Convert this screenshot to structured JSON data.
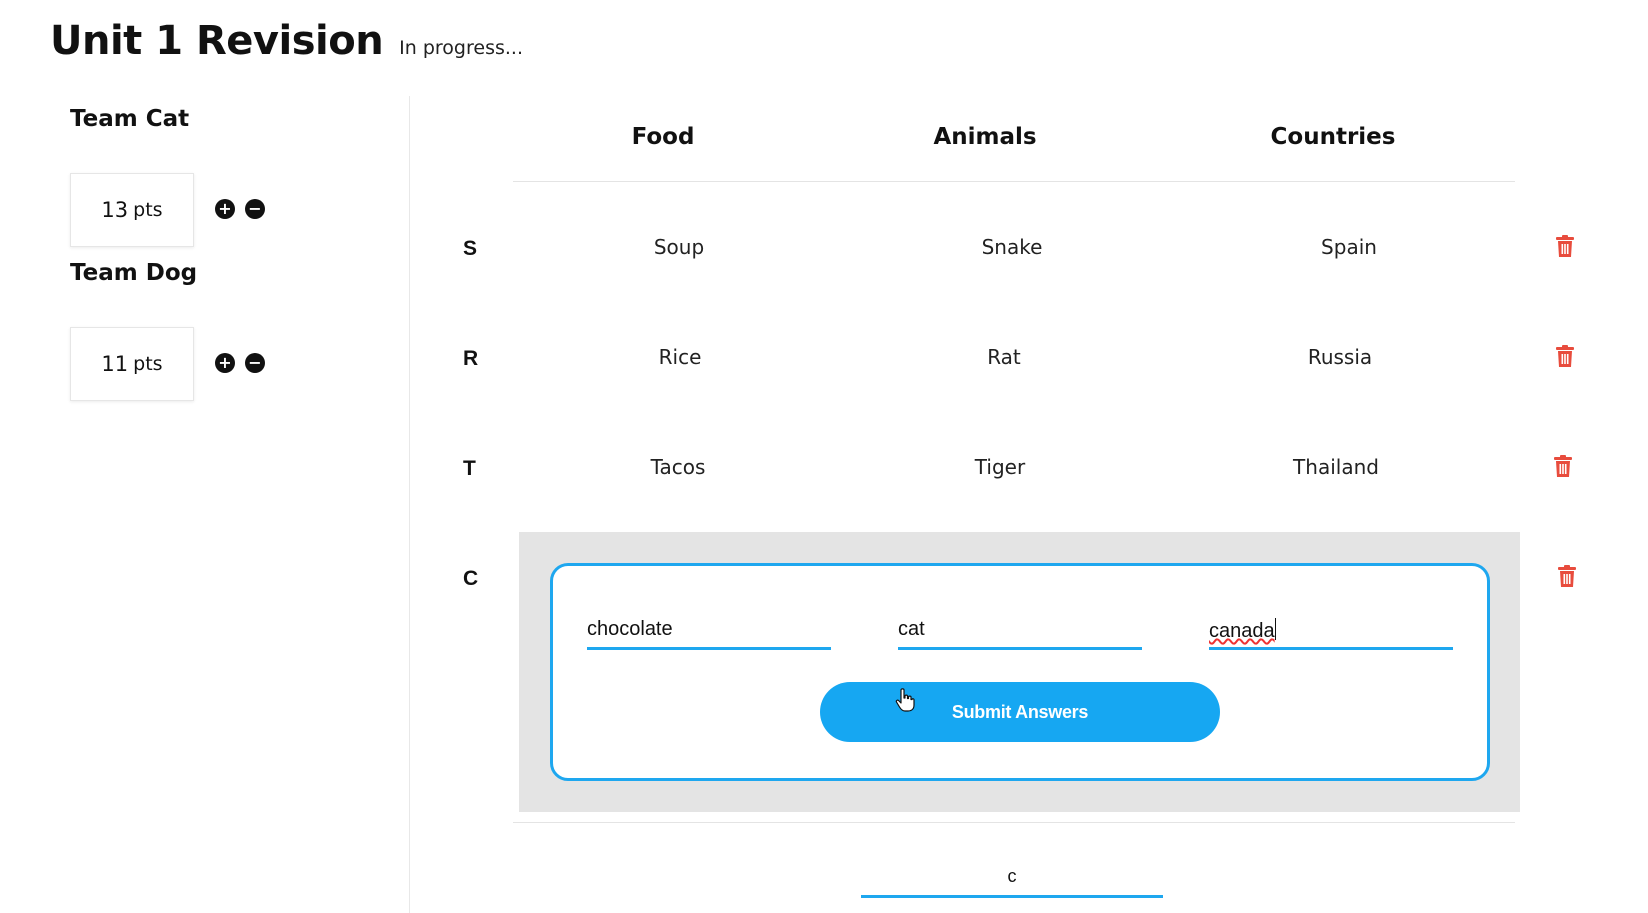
{
  "header": {
    "title": "Unit 1 Revision",
    "status": "In progress..."
  },
  "teams": [
    {
      "name": "Team Cat",
      "score": "13",
      "unit": "pts"
    },
    {
      "name": "Team Dog",
      "score": "11",
      "unit": "pts"
    }
  ],
  "score_controls": {
    "plus": "+",
    "minus": "−"
  },
  "columns": [
    "Food",
    "Animals",
    "Countries"
  ],
  "rows": [
    {
      "letter": "S",
      "food": "Soup",
      "animal": "Snake",
      "country": "Spain"
    },
    {
      "letter": "R",
      "food": "Rice",
      "animal": "Rat",
      "country": "Russia"
    },
    {
      "letter": "T",
      "food": "Tacos",
      "animal": "Tiger",
      "country": "Thailand"
    }
  ],
  "active_row": {
    "letter": "C",
    "food_value": "chocolate",
    "animal_value": "cat",
    "country_value": "canada",
    "submit_label": "Submit Answers"
  },
  "next_letter_input": {
    "value": "c"
  },
  "colors": {
    "accent": "#16a7f2",
    "delete": "#e84c3d",
    "panel": "#e4e4e4"
  },
  "icons": {
    "delete": "trash-icon",
    "add": "plus-circle-icon",
    "remove": "minus-circle-icon",
    "pointer": "hand-pointer-icon"
  }
}
